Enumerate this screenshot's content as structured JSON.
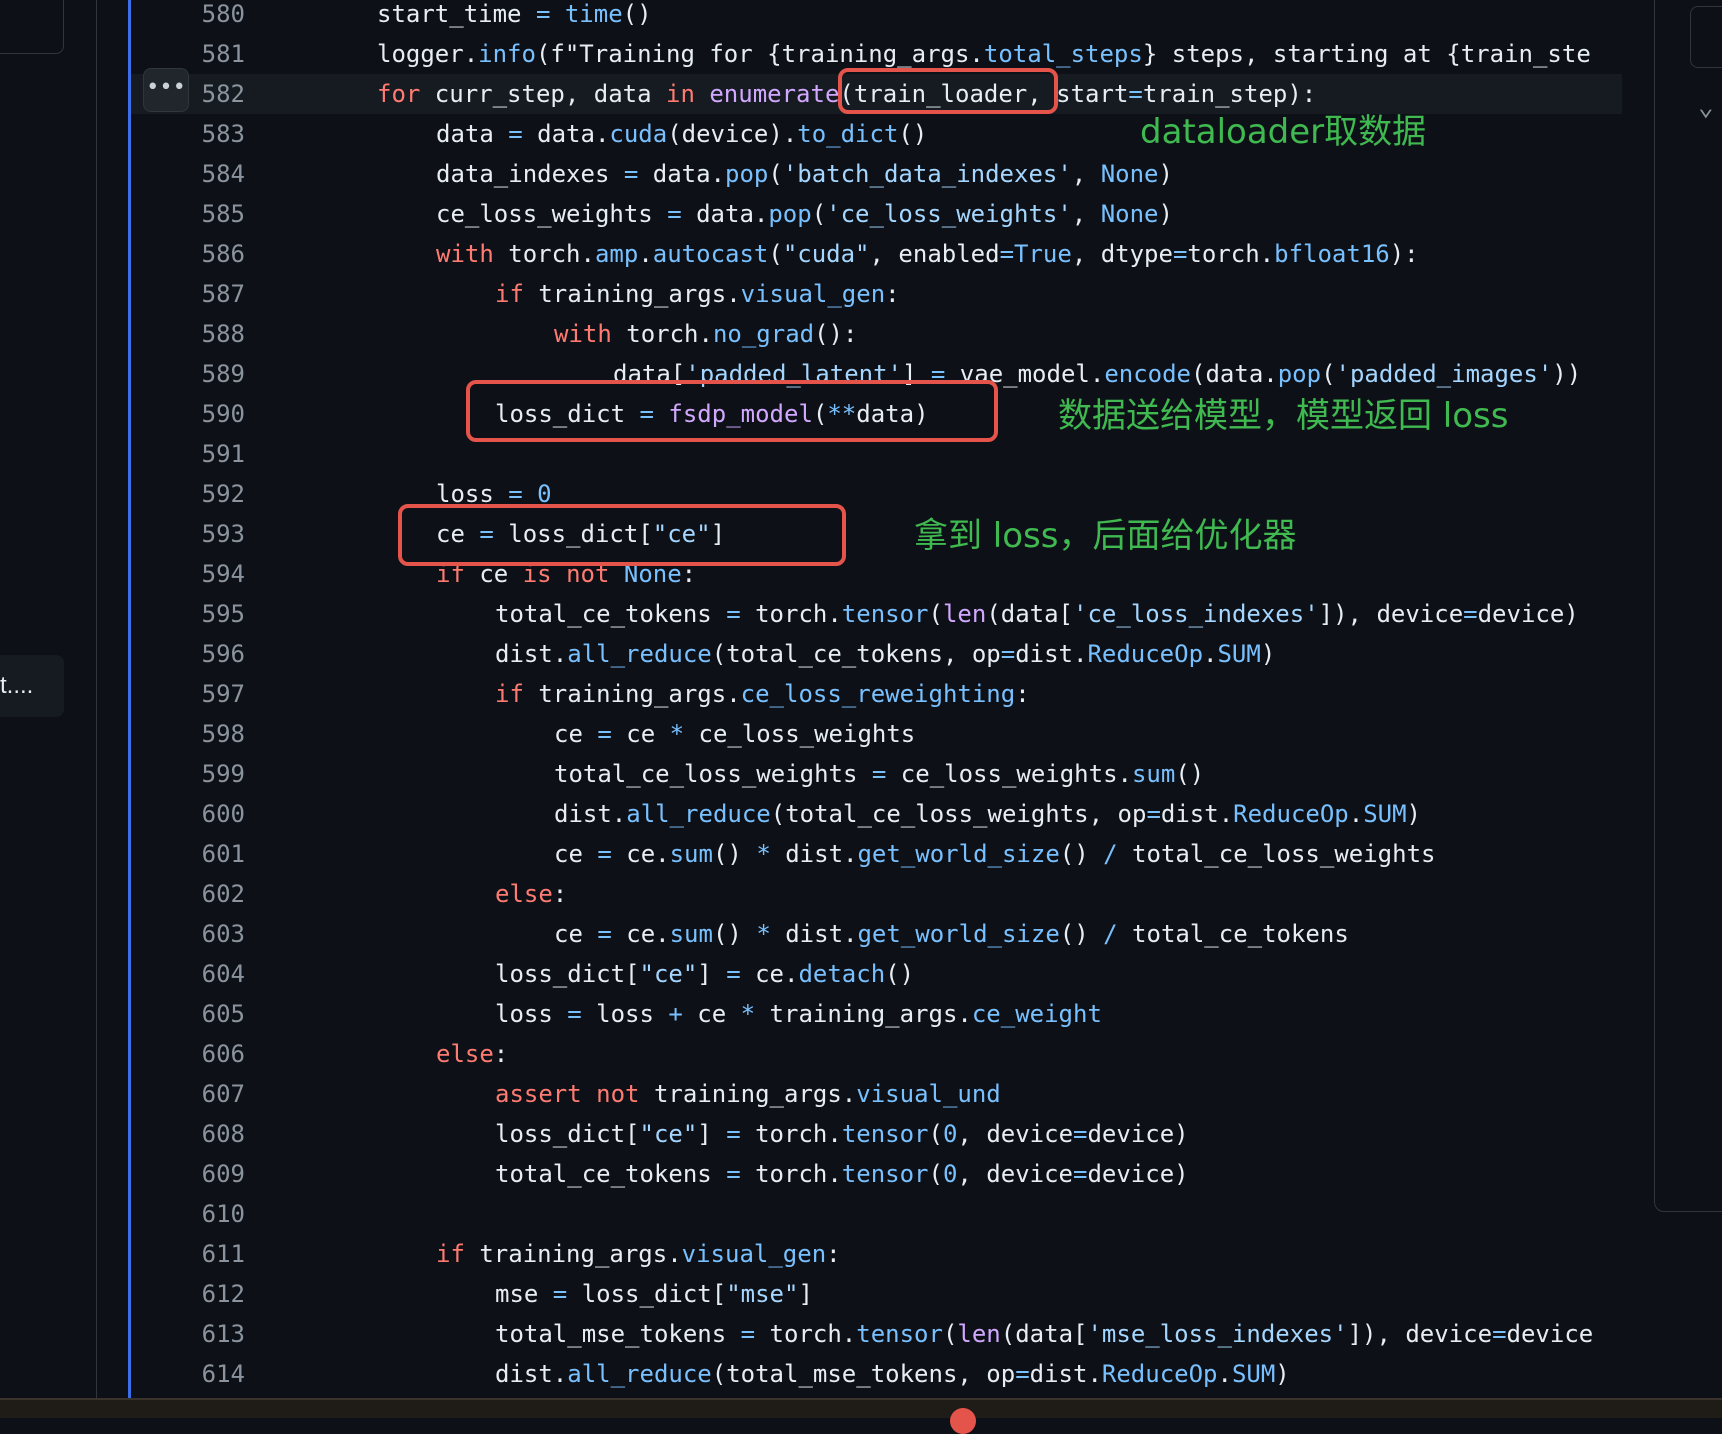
{
  "left_panel": {
    "item_label": "t...."
  },
  "editor": {
    "more_button": "•••",
    "active_line": "582",
    "lines": [
      {
        "n": "580",
        "indent": 0,
        "toks": [
          [
            "pl",
            "start_time "
          ],
          [
            "op",
            "="
          ],
          [
            "pl",
            " "
          ],
          [
            "fn",
            "time"
          ],
          [
            "pl",
            "()"
          ]
        ]
      },
      {
        "n": "581",
        "indent": 0,
        "toks": [
          [
            "pl",
            "logger."
          ],
          [
            "fn",
            "info"
          ],
          [
            "pl",
            "(f\"Training for {training_args."
          ],
          [
            "fn",
            "total_steps"
          ],
          [
            "pl",
            "} steps, starting at {train_ste"
          ]
        ]
      },
      {
        "n": "582",
        "indent": 0,
        "toks": [
          [
            "kw",
            "for"
          ],
          [
            "pl",
            " curr_step, data "
          ],
          [
            "kw",
            "in"
          ],
          [
            "pl",
            " "
          ],
          [
            "bi",
            "enumerate"
          ],
          [
            "pl",
            "(train_loader, start"
          ],
          [
            "op",
            "="
          ],
          [
            "pl",
            "train_step):"
          ]
        ]
      },
      {
        "n": "583",
        "indent": 1,
        "toks": [
          [
            "pl",
            "data "
          ],
          [
            "op",
            "="
          ],
          [
            "pl",
            " data."
          ],
          [
            "fn",
            "cuda"
          ],
          [
            "pl",
            "(device)."
          ],
          [
            "fn",
            "to_dict"
          ],
          [
            "pl",
            "()"
          ]
        ]
      },
      {
        "n": "584",
        "indent": 1,
        "toks": [
          [
            "pl",
            "data_indexes "
          ],
          [
            "op",
            "="
          ],
          [
            "pl",
            " data."
          ],
          [
            "fn",
            "pop"
          ],
          [
            "pl",
            "("
          ],
          [
            "st",
            "'batch_data_indexes'"
          ],
          [
            "pl",
            ", "
          ],
          [
            "nm",
            "None"
          ],
          [
            "pl",
            ")"
          ]
        ]
      },
      {
        "n": "585",
        "indent": 1,
        "toks": [
          [
            "pl",
            "ce_loss_weights "
          ],
          [
            "op",
            "="
          ],
          [
            "pl",
            " data."
          ],
          [
            "fn",
            "pop"
          ],
          [
            "pl",
            "("
          ],
          [
            "st",
            "'ce_loss_weights'"
          ],
          [
            "pl",
            ", "
          ],
          [
            "nm",
            "None"
          ],
          [
            "pl",
            ")"
          ]
        ]
      },
      {
        "n": "586",
        "indent": 1,
        "toks": [
          [
            "kw",
            "with"
          ],
          [
            "pl",
            " torch."
          ],
          [
            "fn",
            "amp"
          ],
          [
            "pl",
            "."
          ],
          [
            "fn",
            "autocast"
          ],
          [
            "pl",
            "("
          ],
          [
            "st",
            "\"cuda\""
          ],
          [
            "pl",
            ", enabled"
          ],
          [
            "op",
            "="
          ],
          [
            "nm",
            "True"
          ],
          [
            "pl",
            ", dtype"
          ],
          [
            "op",
            "="
          ],
          [
            "pl",
            "torch."
          ],
          [
            "fn",
            "bfloat16"
          ],
          [
            "pl",
            "):"
          ]
        ]
      },
      {
        "n": "587",
        "indent": 2,
        "toks": [
          [
            "kw",
            "if"
          ],
          [
            "pl",
            " training_args."
          ],
          [
            "fn",
            "visual_gen"
          ],
          [
            "pl",
            ":"
          ]
        ]
      },
      {
        "n": "588",
        "indent": 3,
        "toks": [
          [
            "kw",
            "with"
          ],
          [
            "pl",
            " torch."
          ],
          [
            "fn",
            "no_grad"
          ],
          [
            "pl",
            "():"
          ]
        ]
      },
      {
        "n": "589",
        "indent": 4,
        "toks": [
          [
            "pl",
            "data["
          ],
          [
            "st",
            "'padded_latent'"
          ],
          [
            "pl",
            "] "
          ],
          [
            "op",
            "="
          ],
          [
            "pl",
            " vae_model."
          ],
          [
            "fn",
            "encode"
          ],
          [
            "pl",
            "(data."
          ],
          [
            "fn",
            "pop"
          ],
          [
            "pl",
            "("
          ],
          [
            "st",
            "'padded_images'"
          ],
          [
            "pl",
            "))"
          ]
        ]
      },
      {
        "n": "590",
        "indent": 2,
        "toks": [
          [
            "pl",
            "loss_dict "
          ],
          [
            "op",
            "="
          ],
          [
            "pl",
            " "
          ],
          [
            "bi",
            "fsdp_model"
          ],
          [
            "pl",
            "("
          ],
          [
            "op",
            "**"
          ],
          [
            "pl",
            "data)"
          ]
        ]
      },
      {
        "n": "591",
        "indent": 0,
        "toks": []
      },
      {
        "n": "592",
        "indent": 1,
        "toks": [
          [
            "pl",
            "loss "
          ],
          [
            "op",
            "="
          ],
          [
            "pl",
            " "
          ],
          [
            "nm",
            "0"
          ]
        ]
      },
      {
        "n": "593",
        "indent": 1,
        "toks": [
          [
            "pl",
            "ce "
          ],
          [
            "op",
            "="
          ],
          [
            "pl",
            " loss_dict["
          ],
          [
            "st",
            "\"ce\""
          ],
          [
            "pl",
            "]"
          ]
        ]
      },
      {
        "n": "594",
        "indent": 1,
        "toks": [
          [
            "kw",
            "if"
          ],
          [
            "pl",
            " ce "
          ],
          [
            "kw",
            "is"
          ],
          [
            "pl",
            " "
          ],
          [
            "kw",
            "not"
          ],
          [
            "pl",
            " "
          ],
          [
            "nm",
            "None"
          ],
          [
            "pl",
            ":"
          ]
        ]
      },
      {
        "n": "595",
        "indent": 2,
        "toks": [
          [
            "pl",
            "total_ce_tokens "
          ],
          [
            "op",
            "="
          ],
          [
            "pl",
            " torch."
          ],
          [
            "fn",
            "tensor"
          ],
          [
            "pl",
            "("
          ],
          [
            "bi",
            "len"
          ],
          [
            "pl",
            "(data["
          ],
          [
            "st",
            "'ce_loss_indexes'"
          ],
          [
            "pl",
            "]), device"
          ],
          [
            "op",
            "="
          ],
          [
            "pl",
            "device)"
          ]
        ]
      },
      {
        "n": "596",
        "indent": 2,
        "toks": [
          [
            "pl",
            "dist."
          ],
          [
            "fn",
            "all_reduce"
          ],
          [
            "pl",
            "(total_ce_tokens, op"
          ],
          [
            "op",
            "="
          ],
          [
            "pl",
            "dist."
          ],
          [
            "fn",
            "ReduceOp"
          ],
          [
            "pl",
            "."
          ],
          [
            "fn",
            "SUM"
          ],
          [
            "pl",
            ")"
          ]
        ]
      },
      {
        "n": "597",
        "indent": 2,
        "toks": [
          [
            "kw",
            "if"
          ],
          [
            "pl",
            " training_args."
          ],
          [
            "fn",
            "ce_loss_reweighting"
          ],
          [
            "pl",
            ":"
          ]
        ]
      },
      {
        "n": "598",
        "indent": 3,
        "toks": [
          [
            "pl",
            "ce "
          ],
          [
            "op",
            "="
          ],
          [
            "pl",
            " ce "
          ],
          [
            "op",
            "*"
          ],
          [
            "pl",
            " ce_loss_weights"
          ]
        ]
      },
      {
        "n": "599",
        "indent": 3,
        "toks": [
          [
            "pl",
            "total_ce_loss_weights "
          ],
          [
            "op",
            "="
          ],
          [
            "pl",
            " ce_loss_weights."
          ],
          [
            "fn",
            "sum"
          ],
          [
            "pl",
            "()"
          ]
        ]
      },
      {
        "n": "600",
        "indent": 3,
        "toks": [
          [
            "pl",
            "dist."
          ],
          [
            "fn",
            "all_reduce"
          ],
          [
            "pl",
            "(total_ce_loss_weights, op"
          ],
          [
            "op",
            "="
          ],
          [
            "pl",
            "dist."
          ],
          [
            "fn",
            "ReduceOp"
          ],
          [
            "pl",
            "."
          ],
          [
            "fn",
            "SUM"
          ],
          [
            "pl",
            ")"
          ]
        ]
      },
      {
        "n": "601",
        "indent": 3,
        "toks": [
          [
            "pl",
            "ce "
          ],
          [
            "op",
            "="
          ],
          [
            "pl",
            " ce."
          ],
          [
            "fn",
            "sum"
          ],
          [
            "pl",
            "() "
          ],
          [
            "op",
            "*"
          ],
          [
            "pl",
            " dist."
          ],
          [
            "fn",
            "get_world_size"
          ],
          [
            "pl",
            "() "
          ],
          [
            "op",
            "/"
          ],
          [
            "pl",
            " total_ce_loss_weights"
          ]
        ]
      },
      {
        "n": "602",
        "indent": 2,
        "toks": [
          [
            "kw",
            "else"
          ],
          [
            "pl",
            ":"
          ]
        ]
      },
      {
        "n": "603",
        "indent": 3,
        "toks": [
          [
            "pl",
            "ce "
          ],
          [
            "op",
            "="
          ],
          [
            "pl",
            " ce."
          ],
          [
            "fn",
            "sum"
          ],
          [
            "pl",
            "() "
          ],
          [
            "op",
            "*"
          ],
          [
            "pl",
            " dist."
          ],
          [
            "fn",
            "get_world_size"
          ],
          [
            "pl",
            "() "
          ],
          [
            "op",
            "/"
          ],
          [
            "pl",
            " total_ce_tokens"
          ]
        ]
      },
      {
        "n": "604",
        "indent": 2,
        "toks": [
          [
            "pl",
            "loss_dict["
          ],
          [
            "st",
            "\"ce\""
          ],
          [
            "pl",
            "] "
          ],
          [
            "op",
            "="
          ],
          [
            "pl",
            " ce."
          ],
          [
            "fn",
            "detach"
          ],
          [
            "pl",
            "()"
          ]
        ]
      },
      {
        "n": "605",
        "indent": 2,
        "toks": [
          [
            "pl",
            "loss "
          ],
          [
            "op",
            "="
          ],
          [
            "pl",
            " loss "
          ],
          [
            "op",
            "+"
          ],
          [
            "pl",
            " ce "
          ],
          [
            "op",
            "*"
          ],
          [
            "pl",
            " training_args."
          ],
          [
            "fn",
            "ce_weight"
          ]
        ]
      },
      {
        "n": "606",
        "indent": 1,
        "toks": [
          [
            "kw",
            "else"
          ],
          [
            "pl",
            ":"
          ]
        ]
      },
      {
        "n": "607",
        "indent": 2,
        "toks": [
          [
            "kw",
            "assert"
          ],
          [
            "pl",
            " "
          ],
          [
            "kw",
            "not"
          ],
          [
            "pl",
            " training_args."
          ],
          [
            "fn",
            "visual_und"
          ]
        ]
      },
      {
        "n": "608",
        "indent": 2,
        "toks": [
          [
            "pl",
            "loss_dict["
          ],
          [
            "st",
            "\"ce\""
          ],
          [
            "pl",
            "] "
          ],
          [
            "op",
            "="
          ],
          [
            "pl",
            " torch."
          ],
          [
            "fn",
            "tensor"
          ],
          [
            "pl",
            "("
          ],
          [
            "nm",
            "0"
          ],
          [
            "pl",
            ", device"
          ],
          [
            "op",
            "="
          ],
          [
            "pl",
            "device)"
          ]
        ]
      },
      {
        "n": "609",
        "indent": 2,
        "toks": [
          [
            "pl",
            "total_ce_tokens "
          ],
          [
            "op",
            "="
          ],
          [
            "pl",
            " torch."
          ],
          [
            "fn",
            "tensor"
          ],
          [
            "pl",
            "("
          ],
          [
            "nm",
            "0"
          ],
          [
            "pl",
            ", device"
          ],
          [
            "op",
            "="
          ],
          [
            "pl",
            "device)"
          ]
        ]
      },
      {
        "n": "610",
        "indent": 0,
        "toks": []
      },
      {
        "n": "611",
        "indent": 1,
        "toks": [
          [
            "kw",
            "if"
          ],
          [
            "pl",
            " training_args."
          ],
          [
            "fn",
            "visual_gen"
          ],
          [
            "pl",
            ":"
          ]
        ]
      },
      {
        "n": "612",
        "indent": 2,
        "toks": [
          [
            "pl",
            "mse "
          ],
          [
            "op",
            "="
          ],
          [
            "pl",
            " loss_dict["
          ],
          [
            "st",
            "\"mse\""
          ],
          [
            "pl",
            "]"
          ]
        ]
      },
      {
        "n": "613",
        "indent": 2,
        "toks": [
          [
            "pl",
            "total_mse_tokens "
          ],
          [
            "op",
            "="
          ],
          [
            "pl",
            " torch."
          ],
          [
            "fn",
            "tensor"
          ],
          [
            "pl",
            "("
          ],
          [
            "bi",
            "len"
          ],
          [
            "pl",
            "(data["
          ],
          [
            "st",
            "'mse_loss_indexes'"
          ],
          [
            "pl",
            "]), device"
          ],
          [
            "op",
            "="
          ],
          [
            "pl",
            "device"
          ]
        ]
      },
      {
        "n": "614",
        "indent": 2,
        "toks": [
          [
            "pl",
            "dist."
          ],
          [
            "fn",
            "all_reduce"
          ],
          [
            "pl",
            "(total_mse_tokens, op"
          ],
          [
            "op",
            "="
          ],
          [
            "pl",
            "dist."
          ],
          [
            "fn",
            "ReduceOp"
          ],
          [
            "pl",
            "."
          ],
          [
            "fn",
            "SUM"
          ],
          [
            "pl",
            ")"
          ]
        ]
      }
    ]
  },
  "annotations": {
    "dataloader": "dataloader取数据",
    "model": "数据送给模型，模型返回 loss",
    "loss": "拿到 loss，后面给优化器"
  },
  "colors": {
    "background": "#0d1117",
    "accent_border": "#3b6ee8",
    "highlight_box": "#e5544b",
    "annotation_text": "#3fb950"
  }
}
